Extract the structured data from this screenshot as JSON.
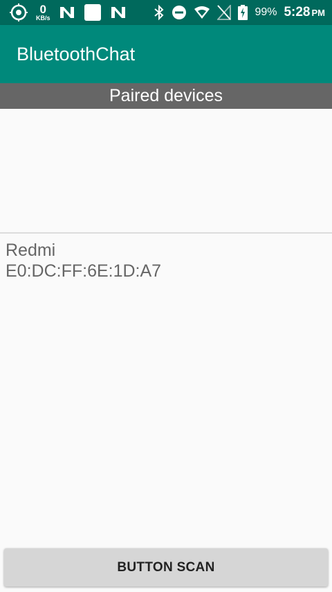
{
  "status_bar": {
    "net_speed_value": "0",
    "net_speed_unit": "KB/s",
    "battery_percent": "99%",
    "time": "5:28",
    "ampm": "PM",
    "icons": [
      "gps-icon",
      "n-logo-icon",
      "square-icon",
      "n-logo-icon",
      "bluetooth-icon",
      "dnd-icon",
      "wifi-icon",
      "signal-icon",
      "battery-icon"
    ]
  },
  "app_bar": {
    "title": "BluetoothChat"
  },
  "paired_section": {
    "header": "Paired devices"
  },
  "devices": [
    {
      "name": "Redmi",
      "address": "E0:DC:FF:6E:1D:A7"
    }
  ],
  "scan_button": {
    "label": "BUTTON SCAN"
  },
  "colors": {
    "status_bar": "#00695c",
    "app_bar": "#00897b",
    "section_header": "#666666",
    "background": "#fafafa"
  }
}
